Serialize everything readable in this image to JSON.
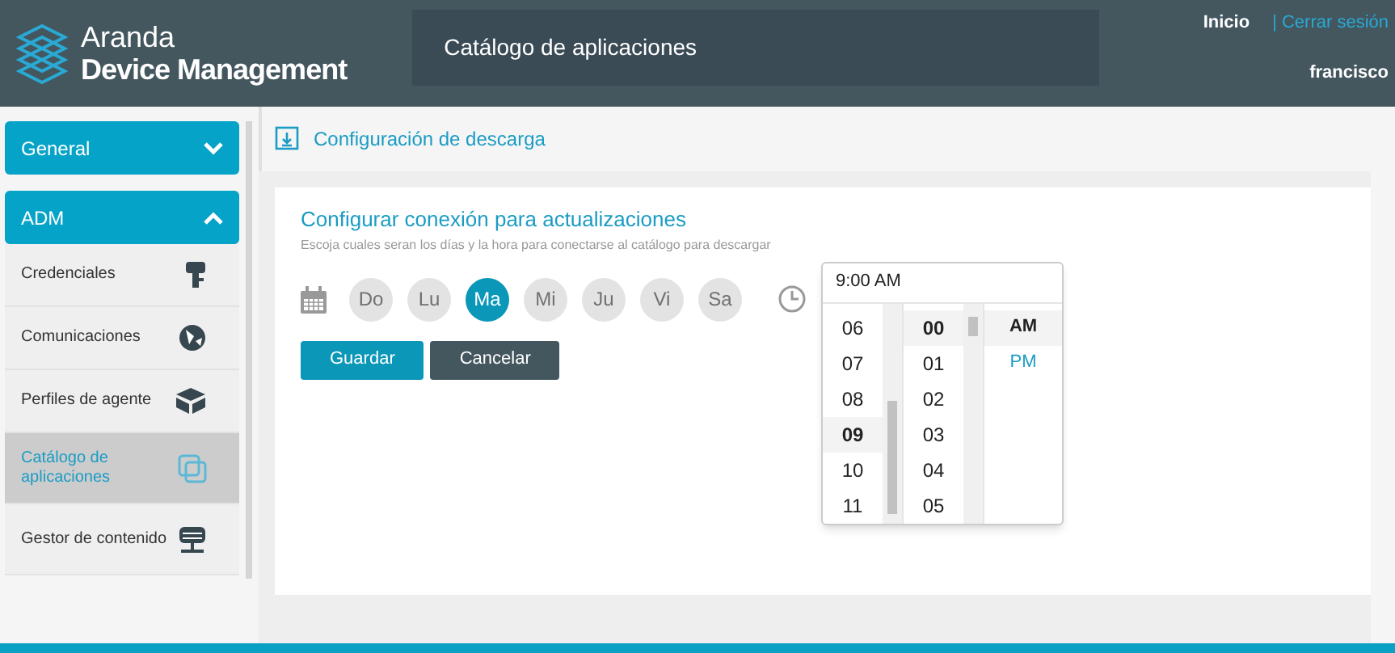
{
  "header": {
    "brand_line1": "Aranda",
    "brand_line2": "Device Management",
    "page_title": "Catálogo de aplicaciones",
    "home_link": "Inicio",
    "logout_link": "| Cerrar sesión",
    "user": "francisco"
  },
  "sidebar": {
    "groups": [
      {
        "label": "General",
        "expanded": false
      },
      {
        "label": "ADM",
        "expanded": true
      }
    ],
    "items": [
      {
        "label": "Credenciales",
        "kind": "key",
        "selected": false
      },
      {
        "label": "Comunicaciones",
        "kind": "globe",
        "selected": false
      },
      {
        "label": "Perfiles de agente",
        "kind": "box",
        "selected": false
      },
      {
        "label": "Catálogo de aplicaciones",
        "kind": "window",
        "selected": true
      },
      {
        "label": "Gestor de contenido",
        "kind": "server",
        "selected": false
      }
    ]
  },
  "section_title": "Configuración de descarga",
  "form": {
    "title": "Configurar conexión para actualizaciones",
    "subtitle": "Escoja cuales seran los días y la hora para conectarse al catálogo para descargar",
    "days": [
      {
        "label": "Do",
        "selected": false
      },
      {
        "label": "Lu",
        "selected": false
      },
      {
        "label": "Ma",
        "selected": true
      },
      {
        "label": "Mi",
        "selected": false
      },
      {
        "label": "Ju",
        "selected": false
      },
      {
        "label": "Vi",
        "selected": false
      },
      {
        "label": "Sa",
        "selected": false
      }
    ],
    "buttons": [
      {
        "label": "Guardar",
        "kind": "primary"
      },
      {
        "label": "Cancelar",
        "kind": "secondary"
      }
    ],
    "time_picker": {
      "value": "9:00 AM",
      "hours": [
        {
          "label": "06",
          "selected": false
        },
        {
          "label": "07",
          "selected": false
        },
        {
          "label": "08",
          "selected": false
        },
        {
          "label": "09",
          "selected": true
        },
        {
          "label": "10",
          "selected": false
        },
        {
          "label": "11",
          "selected": false
        }
      ],
      "minutes": [
        {
          "label": "00",
          "selected": true
        },
        {
          "label": "01",
          "selected": false
        },
        {
          "label": "02",
          "selected": false
        },
        {
          "label": "03",
          "selected": false
        },
        {
          "label": "04",
          "selected": false
        },
        {
          "label": "05",
          "selected": false
        }
      ],
      "periods": [
        {
          "label": "AM",
          "selected": true
        },
        {
          "label": "PM",
          "selected": false
        }
      ]
    }
  }
}
